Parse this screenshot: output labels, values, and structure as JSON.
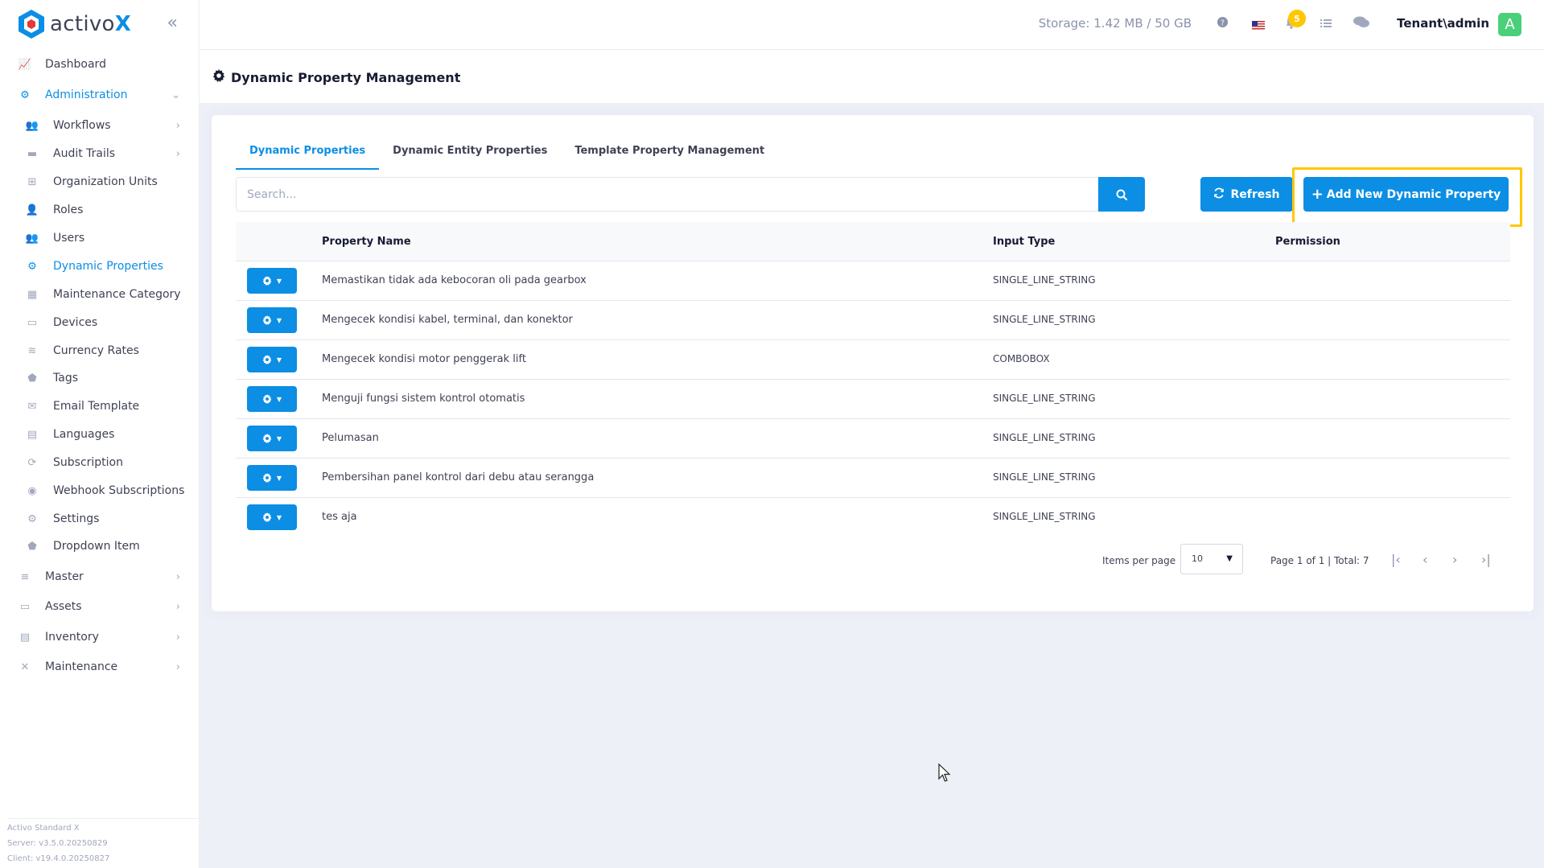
{
  "brand": {
    "name_prefix": "activo",
    "name_suffix": "X",
    "collapse_icon": "double-chevron-left-icon"
  },
  "sidebar": {
    "items": [
      {
        "label": "Dashboard",
        "icon": "chart-icon",
        "level": "top",
        "chevron": ""
      },
      {
        "label": "Administration",
        "icon": "cogs-icon",
        "level": "top",
        "chevron": "⌄",
        "active": true
      },
      {
        "label": "Workflows",
        "icon": "users-icon",
        "level": "sub",
        "chevron": "›"
      },
      {
        "label": "Audit Trails",
        "icon": "folder-icon",
        "level": "sub",
        "chevron": "›"
      },
      {
        "label": "Organization Units",
        "icon": "sitemap-icon",
        "level": "sub",
        "chevron": ""
      },
      {
        "label": "Roles",
        "icon": "user-tag-icon",
        "level": "sub",
        "chevron": ""
      },
      {
        "label": "Users",
        "icon": "users-icon",
        "level": "sub",
        "chevron": ""
      },
      {
        "label": "Dynamic Properties",
        "icon": "gear-icon",
        "level": "sub",
        "chevron": "",
        "active": true
      },
      {
        "label": "Maintenance Category",
        "icon": "grid-icon",
        "level": "sub",
        "chevron": ""
      },
      {
        "label": "Devices",
        "icon": "printer-icon",
        "level": "sub",
        "chevron": ""
      },
      {
        "label": "Currency Rates",
        "icon": "coins-icon",
        "level": "sub",
        "chevron": ""
      },
      {
        "label": "Tags",
        "icon": "tags-icon",
        "level": "sub",
        "chevron": ""
      },
      {
        "label": "Email Template",
        "icon": "envelope-icon",
        "level": "sub",
        "chevron": ""
      },
      {
        "label": "Languages",
        "icon": "language-icon",
        "level": "sub",
        "chevron": ""
      },
      {
        "label": "Subscription",
        "icon": "sync-icon",
        "level": "sub",
        "chevron": ""
      },
      {
        "label": "Webhook Subscriptions",
        "icon": "globe-icon",
        "level": "sub",
        "chevron": ""
      },
      {
        "label": "Settings",
        "icon": "gear-icon",
        "level": "sub",
        "chevron": ""
      },
      {
        "label": "Dropdown Item",
        "icon": "tags-icon",
        "level": "sub",
        "chevron": ""
      },
      {
        "label": "Master",
        "icon": "database-icon",
        "level": "top",
        "chevron": "›"
      },
      {
        "label": "Assets",
        "icon": "laptop-icon",
        "level": "top",
        "chevron": "›"
      },
      {
        "label": "Inventory",
        "icon": "warehouse-icon",
        "level": "top",
        "chevron": "›"
      },
      {
        "label": "Maintenance",
        "icon": "tools-icon",
        "level": "top",
        "chevron": "›"
      }
    ],
    "footer": {
      "product": "Activo Standard X",
      "server": "Server: v3.5.0.20250829",
      "client": "Client: v19.4.0.20250827"
    }
  },
  "header": {
    "storage": "Storage: 1.42 MB / 50 GB",
    "notification_count": "5",
    "user": "Tenant\\admin",
    "avatar_letter": "A",
    "icons": [
      "help-icon",
      "us-flag-icon",
      "bell-icon",
      "list-icon",
      "chat-icon"
    ]
  },
  "page": {
    "title": "Dynamic Property Management"
  },
  "tabs": [
    {
      "label": "Dynamic Properties",
      "active": true
    },
    {
      "label": "Dynamic Entity Properties",
      "active": false
    },
    {
      "label": "Template Property Management",
      "active": false
    }
  ],
  "toolbar": {
    "search_placeholder": "Search...",
    "refresh_label": "Refresh",
    "add_label": "Add New Dynamic Property"
  },
  "table": {
    "columns": [
      "Property Name",
      "Input Type",
      "Permission"
    ],
    "rows": [
      {
        "name": "Memastikan tidak ada kebocoran oli pada gearbox",
        "input_type": "SINGLE_LINE_STRING",
        "permission": ""
      },
      {
        "name": "Mengecek kondisi kabel, terminal, dan konektor",
        "input_type": "SINGLE_LINE_STRING",
        "permission": ""
      },
      {
        "name": "Mengecek kondisi motor penggerak lift",
        "input_type": "COMBOBOX",
        "permission": ""
      },
      {
        "name": "Menguji fungsi sistem kontrol otomatis",
        "input_type": "SINGLE_LINE_STRING",
        "permission": ""
      },
      {
        "name": "Pelumasan",
        "input_type": "SINGLE_LINE_STRING",
        "permission": ""
      },
      {
        "name": "Pembersihan panel kontrol dari debu atau serangga",
        "input_type": "SINGLE_LINE_STRING",
        "permission": ""
      },
      {
        "name": "tes aja",
        "input_type": "SINGLE_LINE_STRING",
        "permission": ""
      }
    ]
  },
  "pagination": {
    "items_per_page_label": "Items per page",
    "items_per_page_value": "10",
    "page_info": "Page 1 of 1 | Total: 7"
  },
  "colors": {
    "accent": "#0b8ee4",
    "highlight": "#ffc700",
    "avatar": "#4bd07a"
  }
}
